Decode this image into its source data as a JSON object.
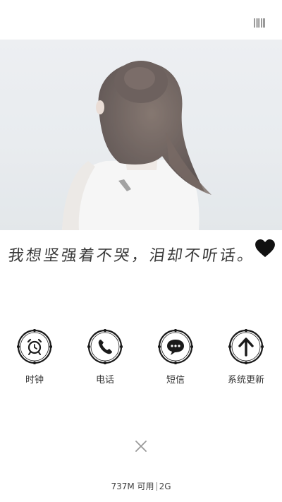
{
  "header": {
    "icon": "barcode-icon"
  },
  "hero": {
    "image": "photo of girl with hair bun seen from behind, pale misty background"
  },
  "quote": {
    "text": "我想坚强着不哭，泪却不听话。",
    "icon": "heart-icon"
  },
  "apps": [
    {
      "label": "时钟",
      "icon": "alarm-clock-icon"
    },
    {
      "label": "电话",
      "icon": "phone-icon"
    },
    {
      "label": "短信",
      "icon": "message-bubble-icon"
    },
    {
      "label": "系统更新",
      "icon": "arrow-up-icon"
    }
  ],
  "footer": {
    "close_icon": "close-icon",
    "memory": "737M 可用",
    "network": "2G"
  },
  "colors": {
    "icon_stroke": "#1a1a1a",
    "background": "#ffffff",
    "text": "#333333"
  }
}
